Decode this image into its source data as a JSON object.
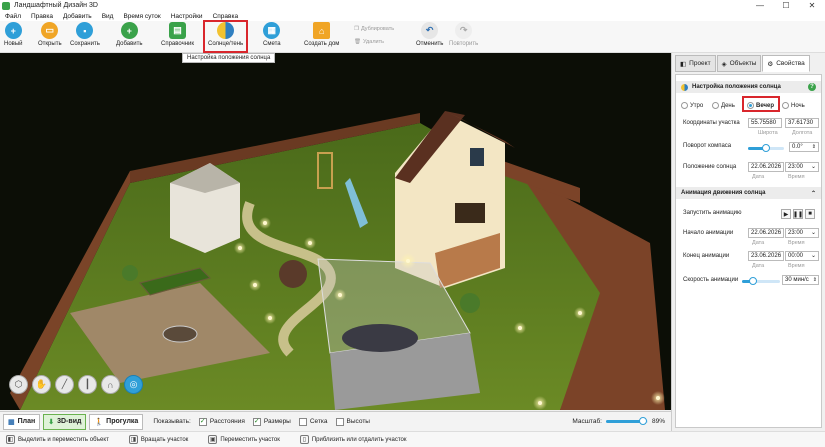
{
  "window": {
    "title": "Ландшафтный Дизайн 3D",
    "minimize": "—",
    "maximize": "☐",
    "close": "✕"
  },
  "menu": [
    "Файл",
    "Правка",
    "Добавить",
    "Вид",
    "Время суток",
    "Настройки",
    "Справка"
  ],
  "toolbar": {
    "new": "Новый",
    "open": "Открыть",
    "save": "Сохранить",
    "add": "Добавить",
    "guide": "Справочник",
    "sun_shadow": "Солнце/тень",
    "estimate": "Смета",
    "build_house": "Создать дом",
    "duplicate": "Дублировать",
    "delete": "Удалить",
    "undo": "Отменить",
    "redo": "Повторить"
  },
  "tooltip": "Настройка положения солнца",
  "right_panel": {
    "tabs": [
      "Проект",
      "Объекты",
      "Свойства"
    ],
    "active_tab": "Свойства",
    "sun": {
      "title": "Настройка положения солнца",
      "help": "?",
      "modes": [
        "Утро",
        "День",
        "Вечер",
        "Ночь"
      ],
      "selected_mode": "Вечер",
      "coords_label": "Координаты участка",
      "latitude": "55.75580",
      "longitude": "37.61730",
      "latitude_label": "Широта",
      "longitude_label": "Долгота",
      "compass_label": "Поворот компаса",
      "compass_value": "0.0°",
      "compass_level": 0.5,
      "sun_position_label": "Положение солнца",
      "date": "22.06.2026",
      "time": "23:00",
      "date_label": "Дата",
      "time_label": "Время"
    },
    "animation": {
      "title": "Анимация движения солнца",
      "start_label": "Запустить анимацию",
      "begin_label": "Начало анимации",
      "begin_date": "22.06.2026",
      "begin_time": "23:00",
      "end_label": "Конец анимации",
      "end_date": "23.06.2026",
      "end_time": "00:00",
      "date_label": "Дата",
      "time_label": "Время",
      "speed_label": "Скорость анимации",
      "speed_value": "30 мин/с",
      "speed_level": 0.3
    }
  },
  "viewbar": {
    "plan": "План",
    "view3d": "3D-вид",
    "walk": "Прогулка",
    "show_label": "Показывать:",
    "checks": [
      {
        "label": "Расстояния",
        "checked": true
      },
      {
        "label": "Размеры",
        "checked": true
      },
      {
        "label": "Сетка",
        "checked": false
      },
      {
        "label": "Высоты",
        "checked": false
      }
    ],
    "scale_label": "Масштаб:",
    "scale_value": "89%",
    "scale_level": 0.89
  },
  "hints": [
    "Выделить и переместить объект",
    "Вращать участок",
    "Переместить участок",
    "Приблизить или отдалить участок"
  ],
  "colors": {
    "accent": "#2f9fd8",
    "highlight": "#d9262c",
    "green": "#3aa24a"
  }
}
